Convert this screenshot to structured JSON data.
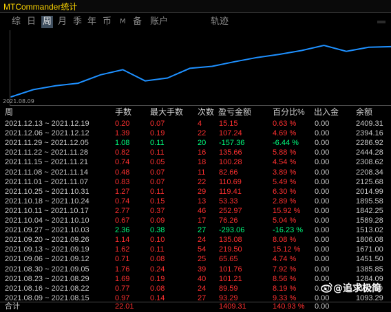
{
  "window": {
    "title": "MTCommander统计"
  },
  "tabs": [
    {
      "label": "综",
      "active": false
    },
    {
      "label": "日",
      "active": false
    },
    {
      "label": "周",
      "active": true
    },
    {
      "label": "月",
      "active": false
    },
    {
      "label": "季",
      "active": false
    },
    {
      "label": "年",
      "active": false
    },
    {
      "label": "币",
      "active": false
    },
    {
      "label": "M",
      "active": false
    },
    {
      "label": "备",
      "active": false
    },
    {
      "label": "账户",
      "active": false
    },
    {
      "label": "轨迹",
      "active": false
    }
  ],
  "chart_data": {
    "type": "line",
    "x_start_label": "2021.08.09",
    "values": [
      1093.29,
      1284.09,
      1385.85,
      1451.5,
      1671.0,
      1806.08,
      1513.02,
      1589.28,
      1842.25,
      1895.58,
      2014.99,
      2125.68,
      2208.34,
      2308.62,
      2444.28,
      2286.92,
      2394.16,
      2409.31
    ],
    "color": "#1e90ff"
  },
  "table": {
    "headers": {
      "week": "周",
      "lots": "手数",
      "max_lots": "最大手数",
      "count": "次数",
      "pnl": "盈亏金额",
      "pct": "百分比%",
      "deposit": "出入金",
      "balance": "余额"
    },
    "rows": [
      {
        "week": "2021.12.13 ~ 2021.12.19",
        "lots": "0.20",
        "max_lots": "0.07",
        "count": "4",
        "pnl": "15.15",
        "pct": "0.63 %",
        "deposit": "0.00",
        "balance": "2409.31",
        "neg": false
      },
      {
        "week": "2021.12.06 ~ 2021.12.12",
        "lots": "1.39",
        "max_lots": "0.19",
        "count": "22",
        "pnl": "107.24",
        "pct": "4.69 %",
        "deposit": "0.00",
        "balance": "2394.16",
        "neg": false
      },
      {
        "week": "2021.11.29 ~ 2021.12.05",
        "lots": "1.08",
        "max_lots": "0.11",
        "count": "20",
        "pnl": "-157.36",
        "pct": "-6.44 %",
        "deposit": "0.00",
        "balance": "2286.92",
        "neg": true
      },
      {
        "week": "2021.11.22 ~ 2021.11.28",
        "lots": "0.82",
        "max_lots": "0.11",
        "count": "16",
        "pnl": "135.66",
        "pct": "5.88 %",
        "deposit": "0.00",
        "balance": "2444.28",
        "neg": false
      },
      {
        "week": "2021.11.15 ~ 2021.11.21",
        "lots": "0.74",
        "max_lots": "0.05",
        "count": "18",
        "pnl": "100.28",
        "pct": "4.54 %",
        "deposit": "0.00",
        "balance": "2308.62",
        "neg": false
      },
      {
        "week": "2021.11.08 ~ 2021.11.14",
        "lots": "0.48",
        "max_lots": "0.07",
        "count": "11",
        "pnl": "82.66",
        "pct": "3.89 %",
        "deposit": "0.00",
        "balance": "2208.34",
        "neg": false
      },
      {
        "week": "2021.11.01 ~ 2021.11.07",
        "lots": "0.83",
        "max_lots": "0.07",
        "count": "22",
        "pnl": "110.69",
        "pct": "5.49 %",
        "deposit": "0.00",
        "balance": "2125.68",
        "neg": false
      },
      {
        "week": "2021.10.25 ~ 2021.10.31",
        "lots": "1.27",
        "max_lots": "0.11",
        "count": "29",
        "pnl": "119.41",
        "pct": "6.30 %",
        "deposit": "0.00",
        "balance": "2014.99",
        "neg": false
      },
      {
        "week": "2021.10.18 ~ 2021.10.24",
        "lots": "0.74",
        "max_lots": "0.15",
        "count": "13",
        "pnl": "53.33",
        "pct": "2.89 %",
        "deposit": "0.00",
        "balance": "1895.58",
        "neg": false
      },
      {
        "week": "2021.10.11 ~ 2021.10.17",
        "lots": "2.77",
        "max_lots": "0.37",
        "count": "46",
        "pnl": "252.97",
        "pct": "15.92 %",
        "deposit": "0.00",
        "balance": "1842.25",
        "neg": false
      },
      {
        "week": "2021.10.04 ~ 2021.10.10",
        "lots": "0.67",
        "max_lots": "0.09",
        "count": "17",
        "pnl": "76.26",
        "pct": "5.04 %",
        "deposit": "0.00",
        "balance": "1589.28",
        "neg": false
      },
      {
        "week": "2021.09.27 ~ 2021.10.03",
        "lots": "2.36",
        "max_lots": "0.38",
        "count": "27",
        "pnl": "-293.06",
        "pct": "-16.23 %",
        "deposit": "0.00",
        "balance": "1513.02",
        "neg": true
      },
      {
        "week": "2021.09.20 ~ 2021.09.26",
        "lots": "1.14",
        "max_lots": "0.10",
        "count": "24",
        "pnl": "135.08",
        "pct": "8.08 %",
        "deposit": "0.00",
        "balance": "1806.08",
        "neg": false
      },
      {
        "week": "2021.09.13 ~ 2021.09.19",
        "lots": "1.62",
        "max_lots": "0.11",
        "count": "54",
        "pnl": "219.50",
        "pct": "15.12 %",
        "deposit": "0.00",
        "balance": "1671.00",
        "neg": false
      },
      {
        "week": "2021.09.06 ~ 2021.09.12",
        "lots": "0.71",
        "max_lots": "0.08",
        "count": "25",
        "pnl": "65.65",
        "pct": "4.74 %",
        "deposit": "0.00",
        "balance": "1451.50",
        "neg": false
      },
      {
        "week": "2021.08.30 ~ 2021.09.05",
        "lots": "1.76",
        "max_lots": "0.24",
        "count": "39",
        "pnl": "101.76",
        "pct": "7.92 %",
        "deposit": "0.00",
        "balance": "1385.85",
        "neg": false
      },
      {
        "week": "2021.08.23 ~ 2021.08.29",
        "lots": "1.69",
        "max_lots": "0.19",
        "count": "40",
        "pnl": "101.21",
        "pct": "8.56 %",
        "deposit": "0.00",
        "balance": "1284.09",
        "neg": false
      },
      {
        "week": "2021.08.16 ~ 2021.08.22",
        "lots": "0.77",
        "max_lots": "0.08",
        "count": "24",
        "pnl": "89.59",
        "pct": "8.19 %",
        "deposit": "0.00",
        "balance": "1182.50",
        "neg": false
      },
      {
        "week": "2021.08.09 ~ 2021.08.15",
        "lots": "0.97",
        "max_lots": "0.14",
        "count": "27",
        "pnl": "93.29",
        "pct": "9.33 %",
        "deposit": "0.00",
        "balance": "1093.29",
        "neg": false
      }
    ],
    "total": {
      "label": "合计",
      "lots": "22.01",
      "pnl": "1409.31",
      "pct": "140.93 %",
      "deposit": "0.00"
    }
  },
  "watermark": {
    "text": "@追求极简",
    "icon": "weibo-icon"
  }
}
